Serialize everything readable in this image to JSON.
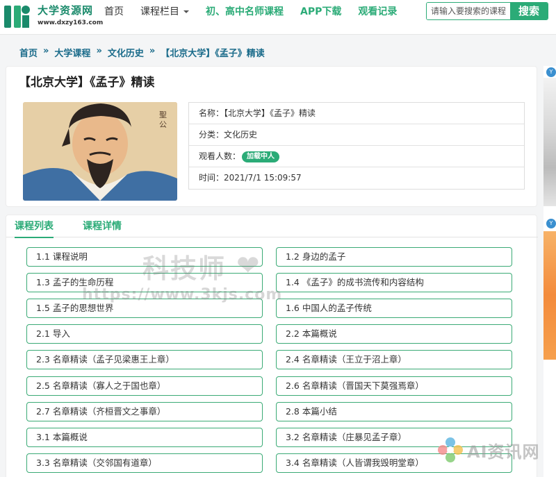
{
  "header": {
    "logo_title": "大学资源网",
    "logo_url": "www.dxzy163.com",
    "nav": {
      "home": "首页",
      "columns": "课程栏目",
      "teachers": "初、高中名师课程",
      "app": "APP下载",
      "history": "观看记录"
    },
    "search_placeholder": "请输入要搜索的课程",
    "search_button": "搜索"
  },
  "breadcrumb": {
    "items": [
      "首页",
      "大学课程",
      "文化历史",
      "【北京大学】《孟子》精读"
    ],
    "separator": "»"
  },
  "course": {
    "title": "【北京大学】《孟子》精读",
    "name_label": "名称：",
    "name_value": "【北京大学】《孟子》精读",
    "category_label": "分类：",
    "category_value": "文化历史",
    "views_label": "观看人数：",
    "views_value": "加载中人",
    "time_label": "时间：",
    "time_value": "2021/7/1 15:09:57"
  },
  "tabs": [
    "课程列表",
    "课程详情"
  ],
  "lessons": [
    "1.1 课程说明",
    "1.2 身边的孟子",
    "1.3 孟子的生命历程",
    "1.4 《孟子》的成书流传和内容结构",
    "1.5 孟子的思想世界",
    "1.6 中国人的孟子传统",
    "2.1 导入",
    "2.2 本篇概说",
    "2.3 名章精读（孟子见梁惠王上章）",
    "2.4 名章精读（王立于沼上章）",
    "2.5 名章精读（寡人之于国也章）",
    "2.6 名章精读（晋国天下莫强焉章）",
    "2.7 名章精读（齐桓晋文之事章）",
    "2.8 本篇小结",
    "3.1 本篇概说",
    "3.2 名章精读（庄暴见孟子章）",
    "3.3 名章精读（交邻国有道章）",
    "3.4 名章精读（人皆谓我毁明堂章）"
  ],
  "watermark": {
    "line1": "科技师",
    "line2": "https://www.3kjs.com"
  },
  "sidebar_badge_text": "Y",
  "ai_badge_text": "AI资讯网",
  "colors": {
    "accent": "#2bab77",
    "breadcrumb": "#1a6b8a"
  }
}
